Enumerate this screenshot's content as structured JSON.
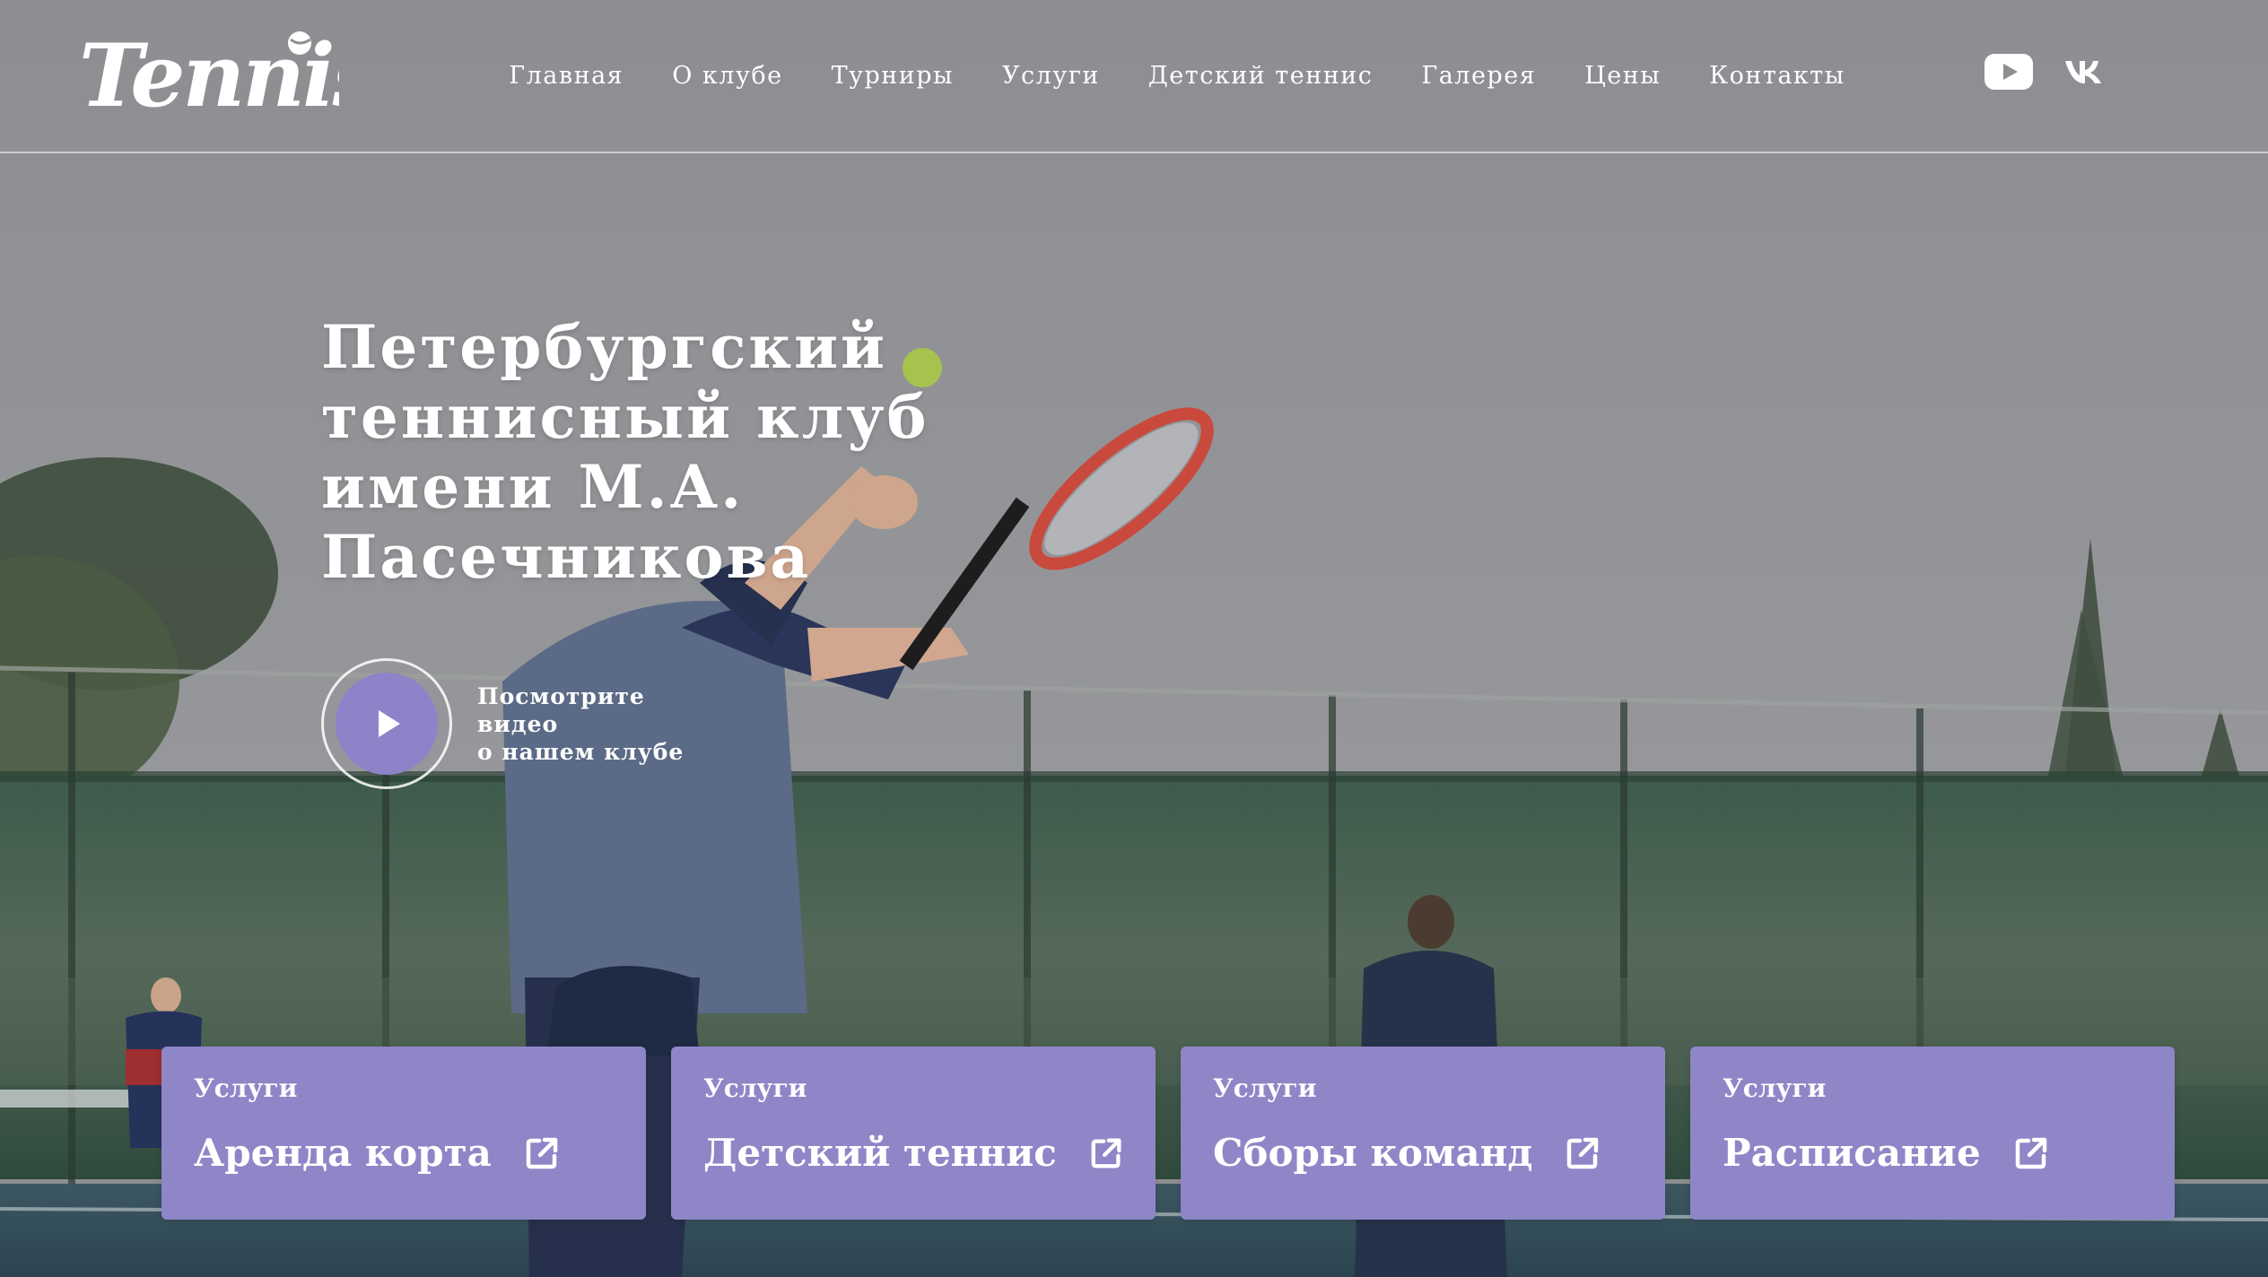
{
  "header": {
    "logo_text": "Tennis",
    "nav": [
      {
        "label": "Главная"
      },
      {
        "label": "О клубе"
      },
      {
        "label": "Турниры"
      },
      {
        "label": "Услуги"
      },
      {
        "label": "Детский теннис"
      },
      {
        "label": "Галерея"
      },
      {
        "label": "Цены"
      },
      {
        "label": "Контакты"
      }
    ],
    "socials": [
      {
        "icon": "youtube-icon"
      },
      {
        "icon": "vk-icon"
      }
    ]
  },
  "hero": {
    "title_lines": [
      "Петербургский",
      "теннисный клуб",
      "имени М.А.",
      "Пасечникова"
    ],
    "video_cta": {
      "line1": "Посмотрите видео",
      "line2": "о нашем клубе",
      "icon": "play-icon"
    }
  },
  "cards": [
    {
      "kicker": "Услуги",
      "title": "Аренда корта",
      "icon": "external-link-icon"
    },
    {
      "kicker": "Услуги",
      "title": "Детский теннис",
      "icon": "external-link-icon"
    },
    {
      "kicker": "Услуги",
      "title": "Сборы команд",
      "icon": "external-link-icon"
    },
    {
      "kicker": "Услуги",
      "title": "Расписание",
      "icon": "external-link-icon"
    }
  ],
  "colors": {
    "accent": "#8f86c8",
    "text": "#ffffff",
    "overlay": "#8e8f92"
  }
}
